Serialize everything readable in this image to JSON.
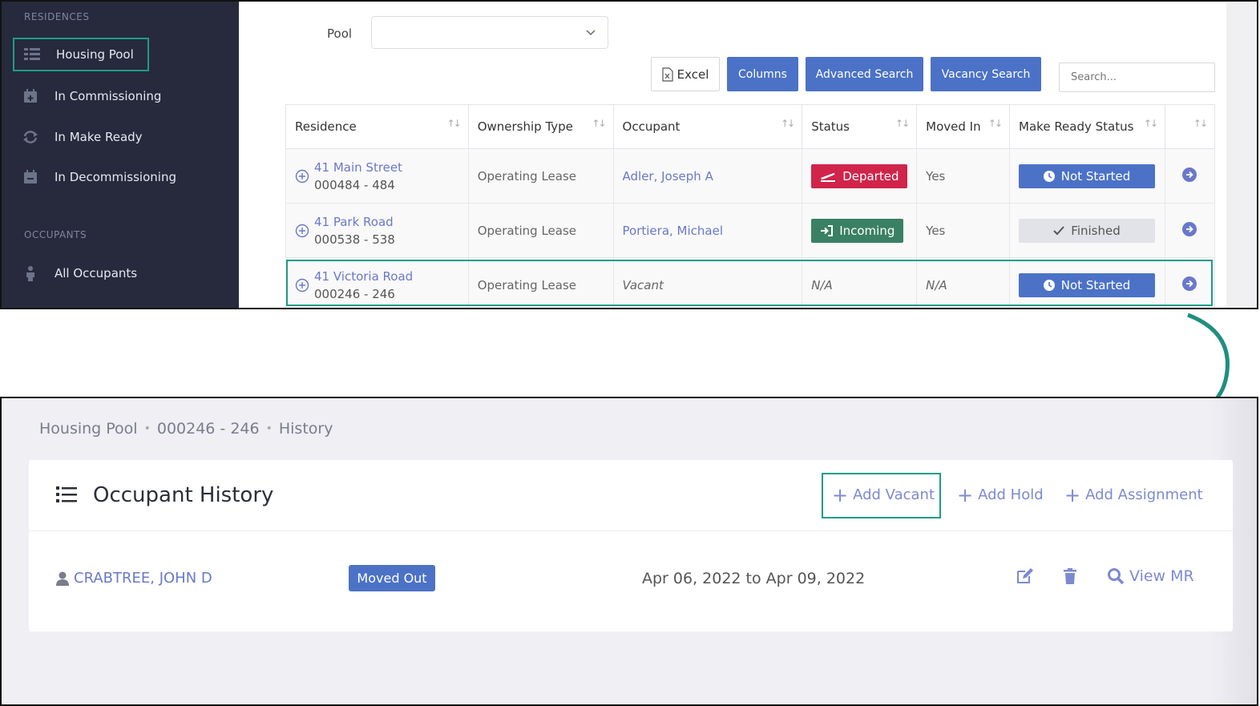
{
  "sidebar": {
    "section_residences": "RESIDENCES",
    "section_occupants": "OCCUPANTS",
    "items": [
      {
        "label": "Housing Pool",
        "icon": "list-grid-icon"
      },
      {
        "label": "In Commissioning",
        "icon": "calendar-plus-icon"
      },
      {
        "label": "In Make Ready",
        "icon": "refresh-icon"
      },
      {
        "label": "In Decommissioning",
        "icon": "calendar-minus-icon"
      },
      {
        "label": "All Occupants",
        "icon": "person-icon"
      }
    ]
  },
  "filters": {
    "pool_label": "Pool",
    "pool_value": ""
  },
  "toolbar": {
    "excel_label": "Excel",
    "columns_label": "Columns",
    "advanced_search_label": "Advanced Search",
    "vacancy_search_label": "Vacancy Search",
    "search_placeholder": "Search..."
  },
  "table": {
    "headers": [
      "Residence",
      "Ownership Type",
      "Occupant",
      "Status",
      "Moved In",
      "Make Ready Status",
      ""
    ],
    "rows": [
      {
        "residence": "41 Main Street",
        "unit": "000484 - 484",
        "ownership": "Operating Lease",
        "occupant": "Adler, Joseph A",
        "status": "Departed",
        "moved_in": "Yes",
        "make_ready": "Not Started"
      },
      {
        "residence": "41 Park Road",
        "unit": "000538 - 538",
        "ownership": "Operating Lease",
        "occupant": "Portiera, Michael",
        "status": "Incoming",
        "moved_in": "Yes",
        "make_ready": "Finished"
      },
      {
        "residence": "41 Victoria Road",
        "unit": "000246 - 246",
        "ownership": "Operating Lease",
        "occupant": "Vacant",
        "status": "N/A",
        "moved_in": "N/A",
        "make_ready": "Not Started"
      }
    ]
  },
  "colors": {
    "accent": "#4b72c6",
    "highlight": "#1e9c87",
    "departed": "#d0244a",
    "incoming": "#3a8065",
    "finished": "#e2e3e8"
  },
  "history": {
    "breadcrumb": [
      "Housing Pool",
      "000246 - 246",
      "History"
    ],
    "title": "Occupant History",
    "actions": {
      "add_vacant": "Add Vacant",
      "add_hold": "Add Hold",
      "add_assignment": "Add Assignment"
    },
    "entry": {
      "occupant": "CRABTREE, JOHN D",
      "status": "Moved Out",
      "date_range": "Apr 06, 2022 to Apr 09, 2022",
      "view_mr": "View MR"
    }
  }
}
